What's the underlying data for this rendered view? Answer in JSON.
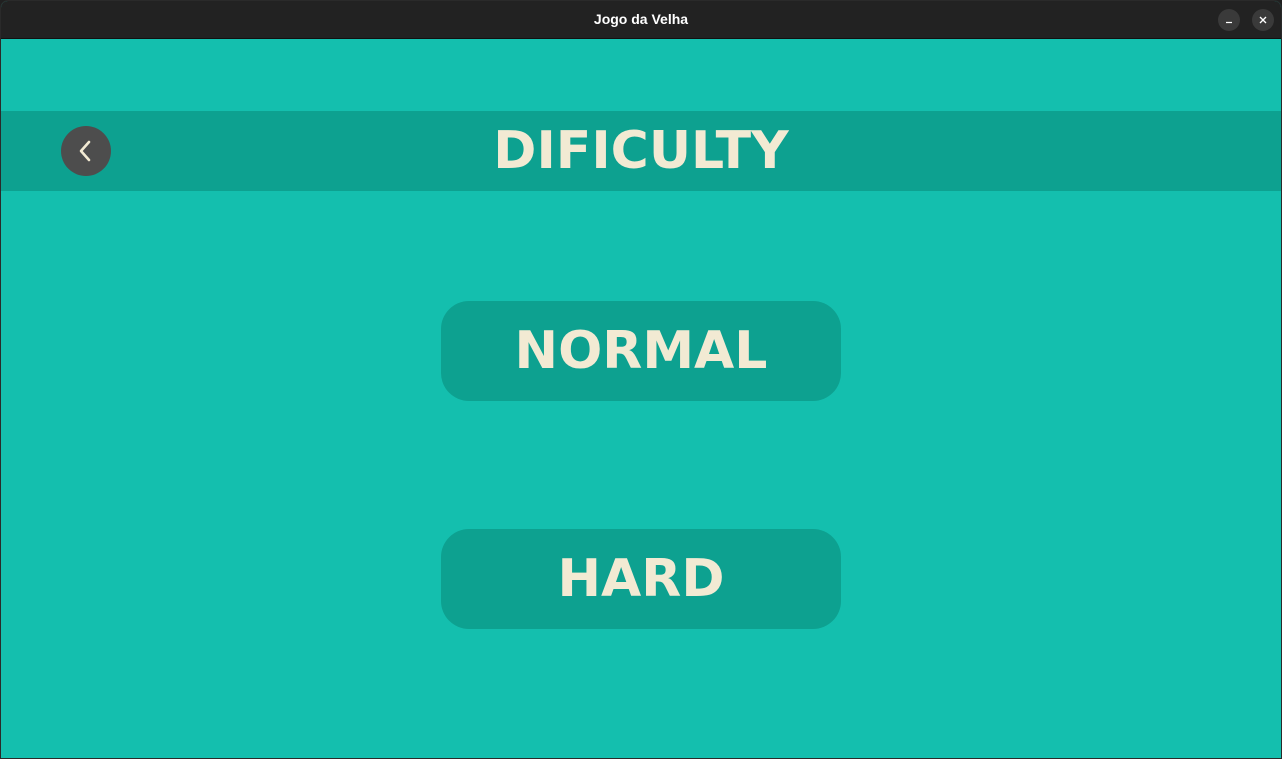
{
  "window": {
    "title": "Jogo da Velha",
    "minimize_icon": "minimize-icon",
    "close_icon": "close-icon"
  },
  "header": {
    "back_icon": "chevron-left-icon",
    "title": "DIFICULTY"
  },
  "difficulty": {
    "normal_label": "NORMAL",
    "hard_label": "HARD"
  },
  "colors": {
    "background": "#14bfae",
    "band": "#0da190",
    "text": "#f2ead3",
    "back_button": "#4d4d4d",
    "titlebar": "#222222"
  }
}
